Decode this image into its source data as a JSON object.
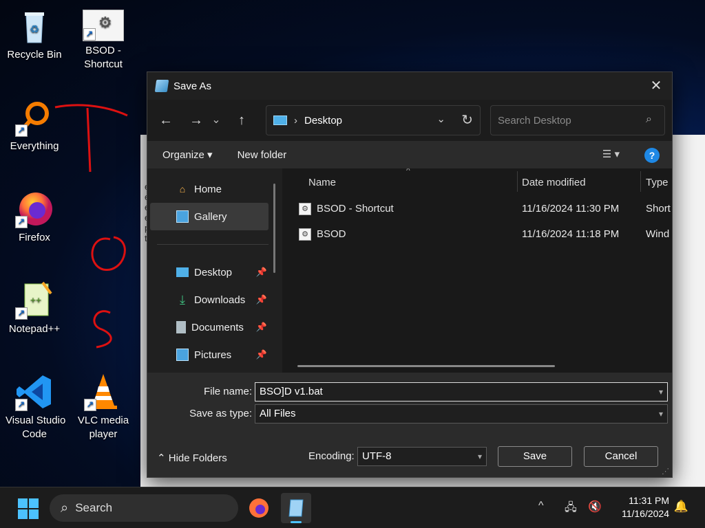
{
  "desktop": {
    "icons": [
      {
        "label": "Recycle Bin"
      },
      {
        "label": "BSOD -\nShortcut"
      },
      {
        "label": "Everything"
      },
      {
        "label": "Firefox"
      },
      {
        "label": "Notepad++"
      },
      {
        "label": "Visual Studio\nCode"
      },
      {
        "label": "VLC media\nplayer"
      }
    ],
    "bg_window_lines": "e\ne\ne\ne\np\nt"
  },
  "dialog": {
    "title": "Save As",
    "close": "✕",
    "nav": {
      "back": "←",
      "forward": "→",
      "recent": "⌄",
      "up": "↑",
      "address_chevron": "›",
      "address": "Desktop",
      "address_dropdown": "⌄",
      "refresh": "↻",
      "search_placeholder": "Search Desktop",
      "search_icon": "⌕"
    },
    "toolbar": {
      "organize": "Organize ▾",
      "new_folder": "New folder",
      "view": "☰ ▾",
      "help": "?"
    },
    "nav_pane": {
      "items": [
        {
          "label": "Home",
          "icon": "home-icon",
          "pinned": false
        },
        {
          "label": "Gallery",
          "icon": "gallery-icon",
          "pinned": false,
          "selected": true
        },
        {
          "label": "Desktop",
          "icon": "desktop-icon",
          "pinned": true
        },
        {
          "label": "Downloads",
          "icon": "downloads-icon",
          "pinned": true
        },
        {
          "label": "Documents",
          "icon": "documents-icon",
          "pinned": true
        },
        {
          "label": "Pictures",
          "icon": "pictures-icon",
          "pinned": true
        }
      ],
      "pin_glyph": "📌"
    },
    "columns": {
      "name": "Name",
      "date": "Date modified",
      "type": "Type",
      "sort": "^"
    },
    "files": [
      {
        "name": "BSOD - Shortcut",
        "date": "11/16/2024 11:30 PM",
        "type": "Short"
      },
      {
        "name": "BSOD",
        "date": "11/16/2024 11:18 PM",
        "type": "Wind"
      }
    ],
    "file_name_label": "File name:",
    "file_name_value": "BSO]D v1.bat",
    "save_type_label": "Save as type:",
    "save_type_value": "All Files",
    "hide_folders": "⌃  Hide Folders",
    "encoding_label": "Encoding:",
    "encoding_value": "UTF-8",
    "save": "Save",
    "cancel": "Cancel",
    "grip": "⋰"
  },
  "taskbar": {
    "search": "Search",
    "search_icon": "⌕",
    "tray_chevron": "^",
    "time": "11:31 PM",
    "date": "11/16/2024",
    "bell": "🔔"
  },
  "colors": {
    "accent": "#4cc2ff",
    "help": "#1e88e5"
  }
}
